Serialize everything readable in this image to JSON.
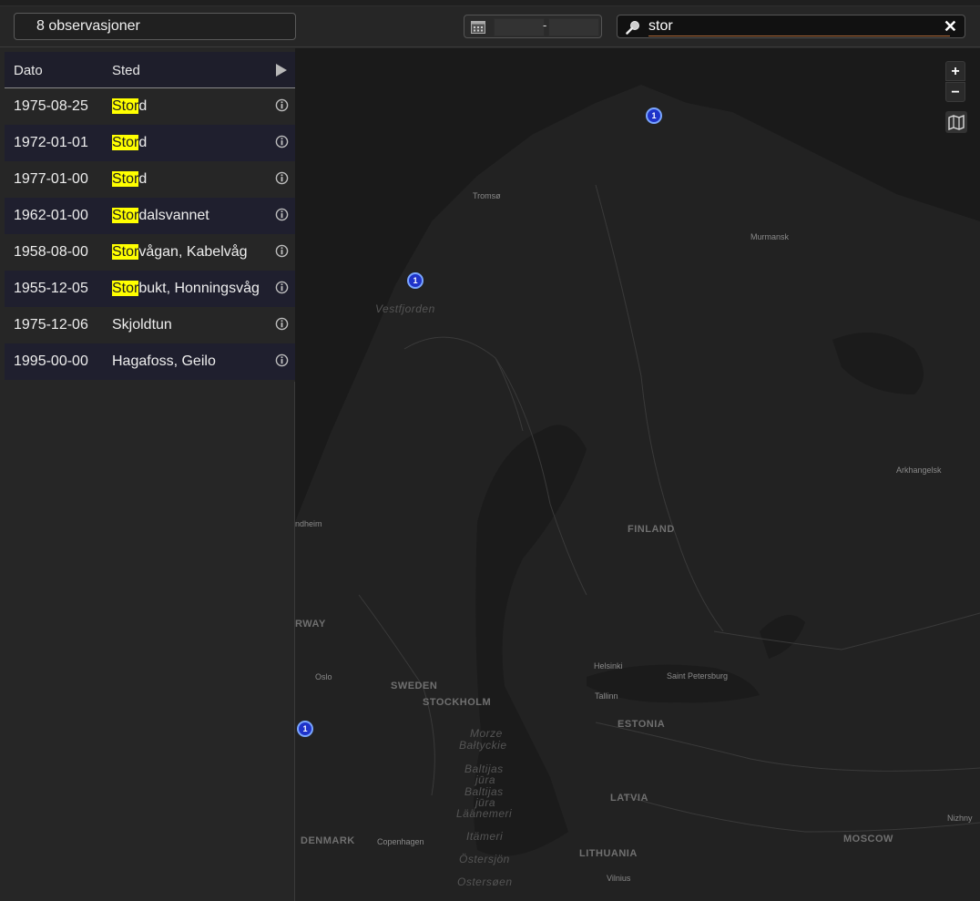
{
  "header": {
    "count_label": "8 observasjoner",
    "date_from": "",
    "date_separator": "-",
    "date_to": "",
    "search_value": "stor",
    "search_clear": "✕"
  },
  "table": {
    "columns": [
      "Dato",
      "Sted"
    ],
    "highlight_term": "Stor",
    "rows": [
      {
        "date": "1975-08-25",
        "place_hl": "Stor",
        "place_rest": "d"
      },
      {
        "date": "1972-01-01",
        "place_hl": "Stor",
        "place_rest": "d"
      },
      {
        "date": "1977-01-00",
        "place_hl": "Stor",
        "place_rest": "d"
      },
      {
        "date": "1962-01-00",
        "place_hl": "Stor",
        "place_rest": "dalsvannet"
      },
      {
        "date": "1958-08-00",
        "place_hl": "Stor",
        "place_rest": "vågan, Kabelvåg"
      },
      {
        "date": "1955-12-05",
        "place_hl": "Stor",
        "place_rest": "bukt, Honningsvåg"
      },
      {
        "date": "1975-12-06",
        "place_hl": "",
        "place_rest": "Skjoldtun"
      },
      {
        "date": "1995-00-00",
        "place_hl": "",
        "place_rest": "Hagafoss, Geilo"
      }
    ]
  },
  "map": {
    "zoom_in": "+",
    "zoom_out": "−",
    "markers": [
      {
        "label": "1"
      },
      {
        "label": "1"
      },
      {
        "label": "1"
      }
    ],
    "labels": {
      "tromso": "Tromsø",
      "murmansk": "Murmansk",
      "vestfjorden": "Vestfjorden",
      "arkhangelsk": "Arkhangelsk",
      "finland": "FINLAND",
      "trondheim": "ndheim",
      "norway": "RWAY",
      "oslo": "Oslo",
      "sweden": "SWEDEN",
      "stockholm": "STOCKHOLM",
      "helsinki": "Helsinki",
      "st_petersburg": "Saint Petersburg",
      "tallinn": "Tallinn",
      "estonia": "ESTONIA",
      "sea1": "Morze",
      "sea2": "Bałtyckie",
      "sea3": "Baltijas",
      "sea4": "jūra",
      "sea5": "Baltijas",
      "sea6": "jūra",
      "sea7": "Läänemeri",
      "sea8": "Itämeri",
      "sea9": "Östersjön",
      "sea10": "Ostersøen",
      "latvia": "LATVIA",
      "denmark": "DENMARK",
      "copenhagen": "Copenhagen",
      "lithuania": "LITHUANIA",
      "moscow": "MOSCOW",
      "vilnius": "Vilnius",
      "nizhny": "Nizhny"
    }
  },
  "colors": {
    "highlight": "#ffff00",
    "marker": "#1f33c9",
    "row_alt": "#1f1f2e"
  }
}
